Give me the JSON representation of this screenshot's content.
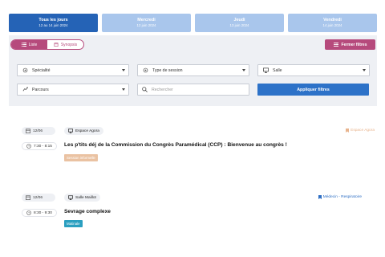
{
  "days": [
    {
      "name": "Tous les jours",
      "date": "12 au 14 juin 2024",
      "active": true
    },
    {
      "name": "Mercredi",
      "date": "12 juin 2024",
      "active": false
    },
    {
      "name": "Jeudi",
      "date": "13 juin 2024",
      "active": false
    },
    {
      "name": "Vendredi",
      "date": "14 juin 2024",
      "active": false
    }
  ],
  "view_toggle": {
    "list_label": "Liste",
    "synopsis_label": "Synopsis"
  },
  "close_filters_label": "Fermer filtres",
  "filters": {
    "specialty": "Spécialité",
    "session_type": "Type de session",
    "room": "Salle",
    "track": "Parcours",
    "search_placeholder": "Rechercher",
    "apply_label": "Appliquer filtres"
  },
  "sessions": [
    {
      "date": "12/06",
      "room": "Espace Agora",
      "audience": "Espace Agora",
      "audience_color": "#e8b48e",
      "time": "7:30 - 8:15",
      "title": "Les p'tits déj de la Commission du Congrès Paramédical (CCP) : Bienvenue au congrès !",
      "tag": "Session informelle",
      "tag_color": "#eac2a2"
    },
    {
      "date": "12/06",
      "room": "Salle Maillot",
      "audience": "Médecin - Respiratoire",
      "audience_color": "#2d6ec4",
      "time": "8:30 - 9:30",
      "title": "Sevrage complexe",
      "tag": "Matinale",
      "tag_color": "#2a9fc0"
    }
  ],
  "colors": {
    "primary": "#2563b6",
    "accent": "#b64a7c",
    "tab_inactive": "#a9c6ec"
  }
}
